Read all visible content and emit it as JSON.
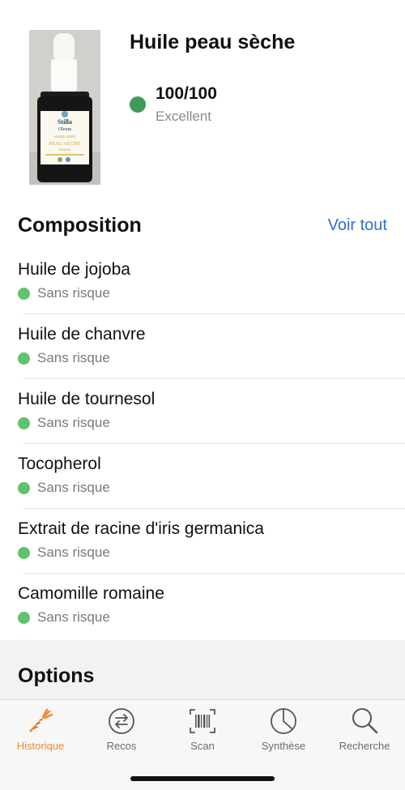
{
  "product": {
    "name": "Huile peau sèche",
    "score": "100/100",
    "rating": "Excellent",
    "score_color": "#3e9a58",
    "photo": {
      "brand": "Stilla",
      "brand_line2": "Oleum",
      "label_line1": "HUILE SOIN",
      "label_line2": "PEAU SÈCHE",
      "label_line3": "VISAGE"
    }
  },
  "composition": {
    "title": "Composition",
    "see_all_label": "Voir tout",
    "items": [
      {
        "name": "Huile de jojoba",
        "status": "Sans risque"
      },
      {
        "name": "Huile de chanvre",
        "status": "Sans risque"
      },
      {
        "name": "Huile de tournesol",
        "status": "Sans risque"
      },
      {
        "name": "Tocopherol",
        "status": "Sans risque"
      },
      {
        "name": "Extrait de racine d'iris germanica",
        "status": "Sans risque"
      },
      {
        "name": "Camomille romaine",
        "status": "Sans risque"
      }
    ],
    "status_color": "#5ec26e"
  },
  "options": {
    "title": "Options"
  },
  "tabbar": {
    "active_color": "#f08b2c",
    "tabs": [
      {
        "label": "Historique",
        "icon": "carrot-icon",
        "active": true
      },
      {
        "label": "Recos",
        "icon": "swap-arrows-icon",
        "active": false
      },
      {
        "label": "Scan",
        "icon": "barcode-icon",
        "active": false
      },
      {
        "label": "Synthèse",
        "icon": "pie-chart-icon",
        "active": false
      },
      {
        "label": "Recherche",
        "icon": "magnifier-icon",
        "active": false
      }
    ]
  }
}
